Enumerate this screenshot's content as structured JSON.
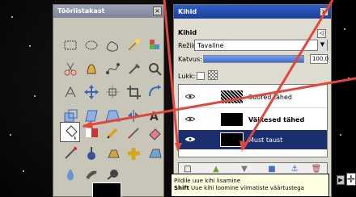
{
  "toolbox": {
    "title": "Tööriistakast",
    "close_label": "×"
  },
  "layers": {
    "title": "Kihid",
    "heading": "Kihid",
    "mode_label": "Režiim:",
    "mode_value": "Tavaline",
    "opacity_label": "Katvus:",
    "opacity_value": "100,0",
    "lock_label": "Lukk:",
    "layer_items": [
      {
        "name": "Suured tähed"
      },
      {
        "name": "Väikesed tähed"
      },
      {
        "name": "Must taust"
      }
    ],
    "actions": [
      "new-layer",
      "raise-layer",
      "lower-layer",
      "duplicate-layer",
      "anchor-layer",
      "delete-layer"
    ],
    "close_label": "×",
    "mini_label": "◁"
  },
  "tooltip": {
    "line1": "Pildile uue kihi lisamine",
    "line2_key": "Shift",
    "line2_text": " Uue kihi loomine viimatiste väärtustega"
  },
  "colors": {
    "accent": "#2f5fc5",
    "selected_row": "#1b2f6e",
    "annotation": "#e0473f"
  }
}
